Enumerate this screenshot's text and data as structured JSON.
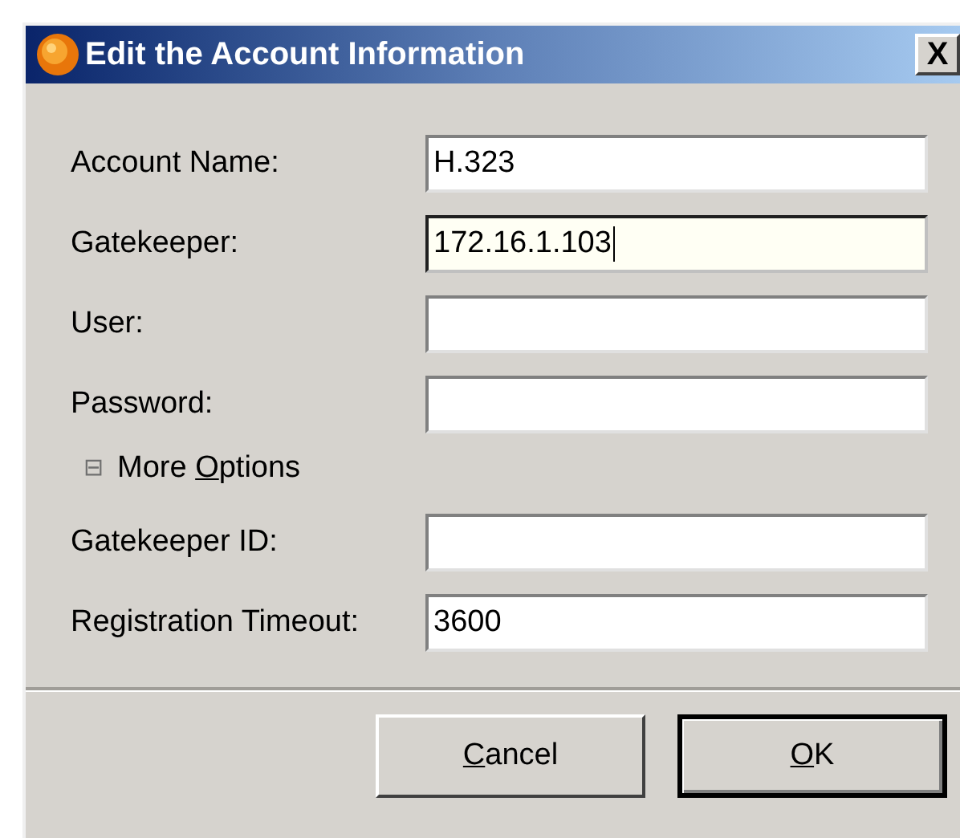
{
  "window": {
    "title": "Edit the Account Information",
    "close": "X"
  },
  "fields": [
    {
      "label": "Account Name:",
      "value": "H.323",
      "focused": false
    },
    {
      "label": "Gatekeeper:",
      "value": "172.16.1.103",
      "focused": true
    },
    {
      "label": "User:",
      "focused": false
    },
    {
      "label": "Password:",
      "focused": false
    }
  ],
  "more_options": {
    "expander": "⊟",
    "before": "More ",
    "key": "O",
    "after": "ptions",
    "expanded": true
  },
  "more_fields": [
    {
      "label": "Gatekeeper ID:",
      "focused": false
    },
    {
      "label": "Registration Timeout:",
      "value": "3600",
      "focused": false
    }
  ],
  "buttons": [
    {
      "key": "C",
      "rest": "ancel",
      "default": false
    },
    {
      "key": "O",
      "rest": "K",
      "default": true
    }
  ]
}
